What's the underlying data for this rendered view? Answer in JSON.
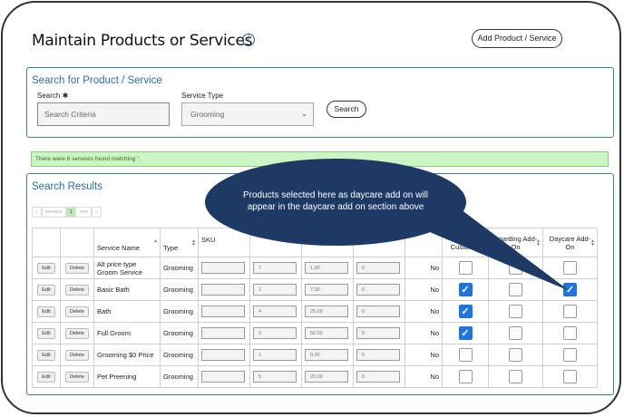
{
  "header": {
    "title": "Maintain Products or Services",
    "info_icon": "i",
    "add_button": "Add Product / Service"
  },
  "search": {
    "title": "Search for Product / Service",
    "search_label": "Search ✱",
    "search_placeholder": "Search Criteria",
    "type_label": "Service Type",
    "type_value": "Grooming",
    "search_button": "Search"
  },
  "alert": {
    "text": "There were 8 services found matching ''."
  },
  "results": {
    "title": "Search Results",
    "pager": {
      "previous": "previous",
      "current": "1",
      "next": "next"
    },
    "columns": [
      "",
      "",
      "Service Name",
      "Type",
      "SKU",
      "",
      "",
      "",
      "",
      "Show to Customer",
      "Boarding Add-On",
      "Daycare Add-On"
    ],
    "rows": [
      {
        "edit": "Edit",
        "delete": "Delete",
        "name": "Alt price type Groom Service",
        "type": "Grooming",
        "sku": "",
        "v1": "7",
        "v2": "1.00",
        "v3": "0",
        "flag": "No",
        "show": false,
        "boarding": false,
        "daycare": false
      },
      {
        "edit": "Edit",
        "delete": "Delete",
        "name": "Basic Bath",
        "type": "Grooming",
        "sku": "",
        "v1": "1",
        "v2": "7.00",
        "v3": "0",
        "flag": "No",
        "show": true,
        "boarding": false,
        "daycare": true
      },
      {
        "edit": "Edit",
        "delete": "Delete",
        "name": "Bath",
        "type": "Grooming",
        "sku": "",
        "v1": "4",
        "v2": "25.00",
        "v3": "0",
        "flag": "No",
        "show": true,
        "boarding": false,
        "daycare": false
      },
      {
        "edit": "Edit",
        "delete": "Delete",
        "name": "Full Groom",
        "type": "Grooming",
        "sku": "",
        "v1": "3",
        "v2": "50.00",
        "v3": "0",
        "flag": "No",
        "show": true,
        "boarding": false,
        "daycare": false
      },
      {
        "edit": "Edit",
        "delete": "Delete",
        "name": "Grooming $0 Price",
        "type": "Grooming",
        "sku": "",
        "v1": "1",
        "v2": "0.00",
        "v3": "0",
        "flag": "No",
        "show": false,
        "boarding": false,
        "daycare": false
      },
      {
        "edit": "Edit",
        "delete": "Delete",
        "name": "Pet Preening",
        "type": "Grooming",
        "sku": "",
        "v1": "5",
        "v2": "20.00",
        "v3": "0",
        "flag": "No",
        "show": false,
        "boarding": false,
        "daycare": false
      }
    ]
  },
  "callout": {
    "text": "Products selected here as daycare add on will appear in the daycare add on section above"
  },
  "colors": {
    "accent": "#2e6da4",
    "callout": "#1d3a64",
    "checked": "#1f74e0",
    "alert_bg": "#ccf5c4"
  }
}
